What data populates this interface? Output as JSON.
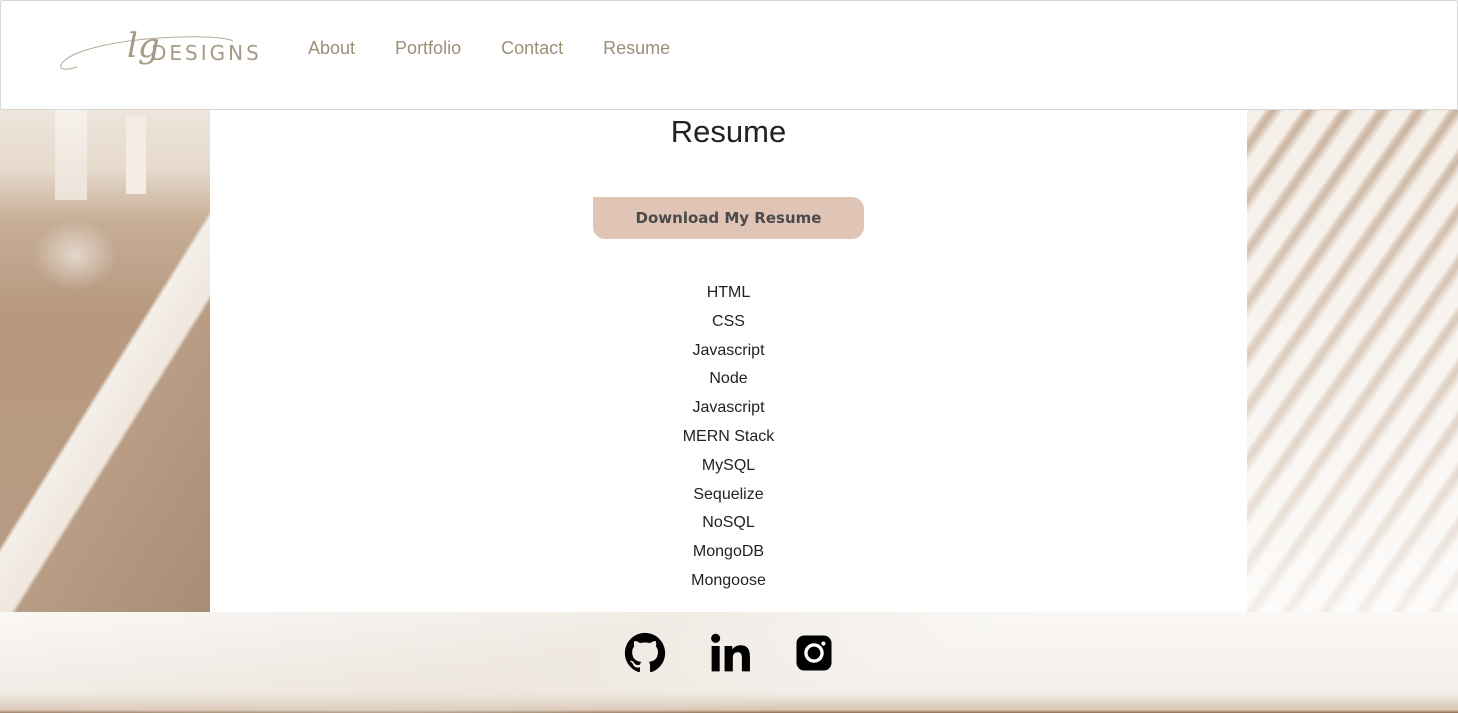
{
  "brand": {
    "script_mark": "lg",
    "name": "DESIGNS",
    "color": "#a69a86"
  },
  "nav": {
    "items": [
      {
        "label": "About"
      },
      {
        "label": "Portfolio"
      },
      {
        "label": "Contact"
      },
      {
        "label": "Resume"
      }
    ]
  },
  "main": {
    "title": "Resume",
    "download_label": "Download My Resume",
    "skills": [
      "HTML",
      "CSS",
      "Javascript",
      "Node",
      "Javascript",
      "MERN Stack",
      "MySQL",
      "Sequelize",
      "NoSQL",
      "MongoDB",
      "Mongoose"
    ]
  },
  "footer": {
    "social": [
      {
        "icon": "github-icon"
      },
      {
        "icon": "linkedin-icon"
      },
      {
        "icon": "instagram-icon"
      }
    ]
  },
  "colors": {
    "accent_button": "#e0c5b6",
    "nav_text": "#9c8f78"
  }
}
